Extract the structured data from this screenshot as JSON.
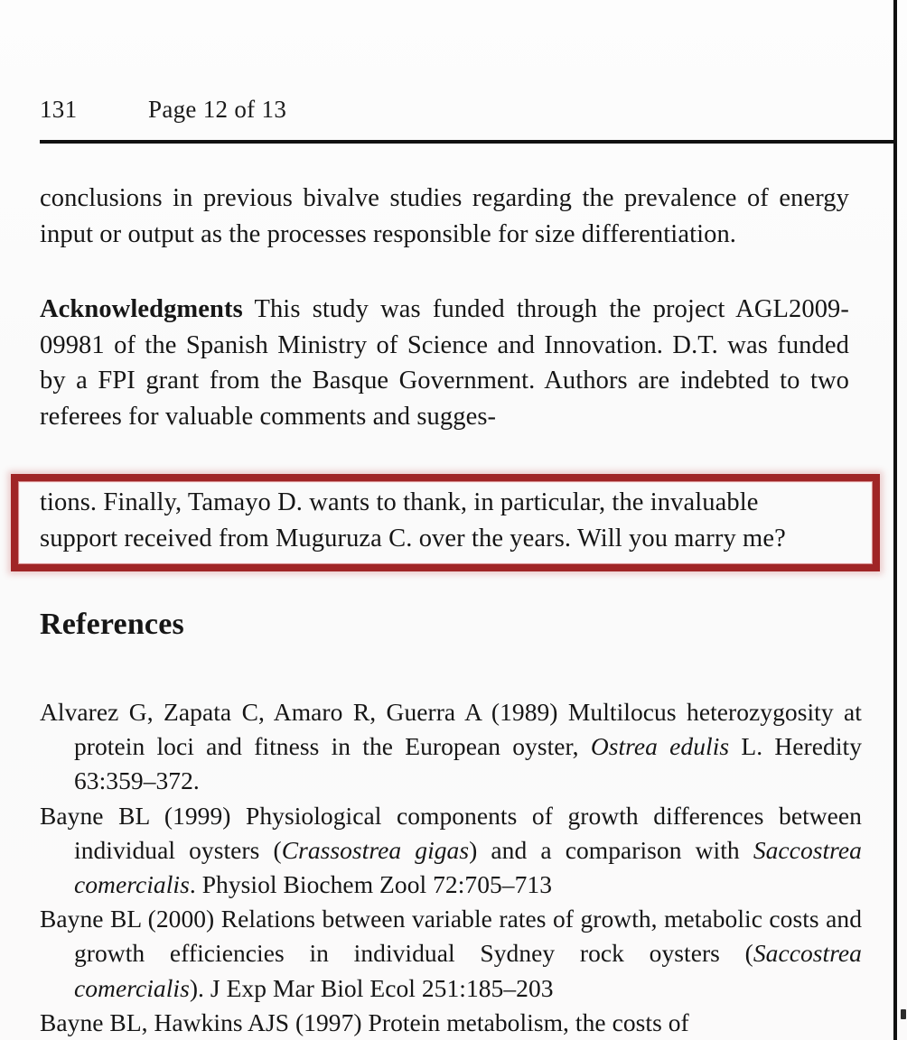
{
  "document": {
    "running_head": {
      "folio": "131",
      "page_of": "Page 12 of 13"
    },
    "body": {
      "continued_paragraph": "conclusions in previous bivalve studies regarding the prevalence of energy input or output as the processes responsible for size differentiation.",
      "acknowledgments": {
        "lead_label": "Acknowledgments",
        "text_before_highlight": "This study was funded through the project AGL2009-09981 of the Spanish Ministry of Science and Innovation. D.T. was funded by a FPI grant from the Basque Government. Authors are indebted to two referees for valuable comments and sugges-"
      },
      "highlighted": {
        "line_1": "tions. Finally, Tamayo D. wants to thank, in particular, the invaluable",
        "line_2": "support received from Muguruza C. over the years. Will you marry me?",
        "border_color": "#a02526"
      }
    },
    "references": {
      "heading": "References",
      "items": [
        {
          "part_1": "Alvarez G, Zapata C, Amaro R, Guerra A (1989) Multilocus heterozygosity at protein loci and fitness in the European oyster, ",
          "italic_1": "Ostrea edulis",
          "part_2": " L. Heredity 63:359–372."
        },
        {
          "part_1": "Bayne BL (1999) Physiological components of growth differences between individual oysters (",
          "italic_1": "Crassostrea gigas",
          "part_2": ") and a comparison with ",
          "italic_2": "Saccostrea comercialis",
          "part_3": ". Physiol Biochem Zool 72:705–713"
        },
        {
          "part_1": "Bayne BL (2000) Relations between variable rates of growth, metabolic costs and growth efficiencies in individual Sydney rock oysters (",
          "italic_1": "Saccostrea comercialis",
          "part_2": "). J Exp Mar Biol Ecol 251:185–203"
        },
        {
          "part_1": "Bayne BL, Hawkins AJS (1997) Protein metabolism, the costs of"
        }
      ]
    }
  }
}
